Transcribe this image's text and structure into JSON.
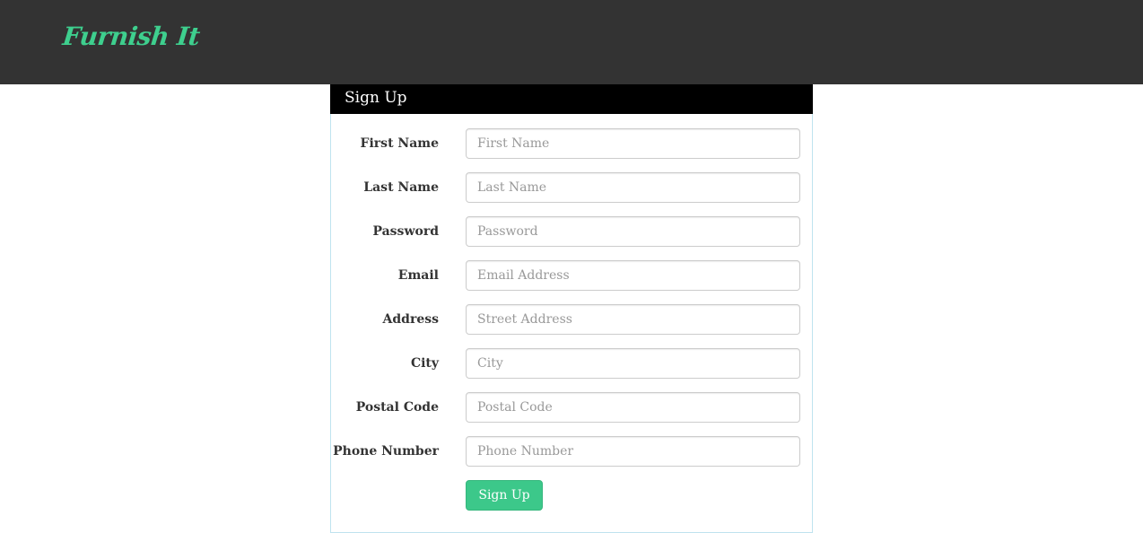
{
  "navbar": {
    "brand": "Furnish It",
    "brand_color": "#3ecf8e",
    "background": "#333333"
  },
  "panel": {
    "title": "Sign Up",
    "fields": [
      {
        "label": "First Name",
        "placeholder": "First Name",
        "value": ""
      },
      {
        "label": "Last Name",
        "placeholder": "Last Name",
        "value": ""
      },
      {
        "label": "Password",
        "placeholder": "Password",
        "value": ""
      },
      {
        "label": "Email",
        "placeholder": "Email Address",
        "value": ""
      },
      {
        "label": "Address",
        "placeholder": "Street Address",
        "value": ""
      },
      {
        "label": "City",
        "placeholder": "City",
        "value": ""
      },
      {
        "label": "Postal Code",
        "placeholder": "Postal Code",
        "value": ""
      },
      {
        "label": "Phone Number",
        "placeholder": "Phone Number",
        "value": ""
      }
    ],
    "submit_label": "Sign Up",
    "submit_color": "#3cc88a"
  }
}
